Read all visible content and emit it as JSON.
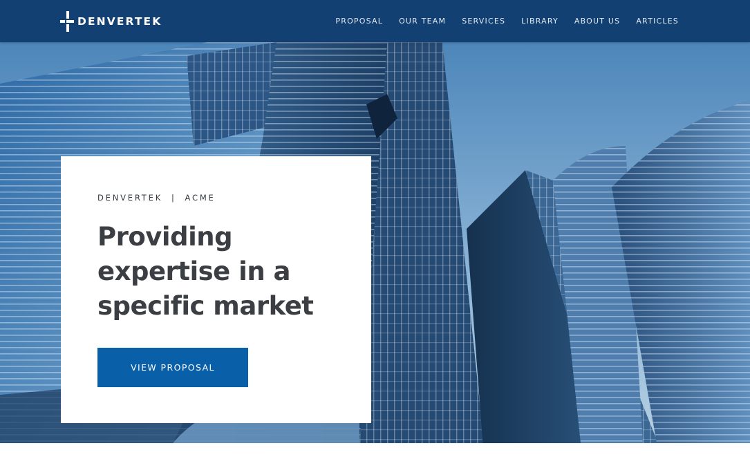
{
  "brand": {
    "name": "DENVERTEK"
  },
  "nav": {
    "items": [
      {
        "label": "PROPOSAL"
      },
      {
        "label": "OUR TEAM"
      },
      {
        "label": "SERVICES"
      },
      {
        "label": "LIBRARY"
      },
      {
        "label": "ABOUT US"
      },
      {
        "label": "ARTICLES"
      }
    ]
  },
  "hero": {
    "eyebrow": "DENVERTEK  |  ACME",
    "headline": "Providing expertise in a specific market",
    "cta_label": "VIEW PROPOSAL",
    "background_image": "skyscraper-photo"
  },
  "colors": {
    "navbar": "#134072",
    "cta": "#0a5fa9",
    "card": "#ffffff",
    "headline_text": "#3b3e43"
  }
}
